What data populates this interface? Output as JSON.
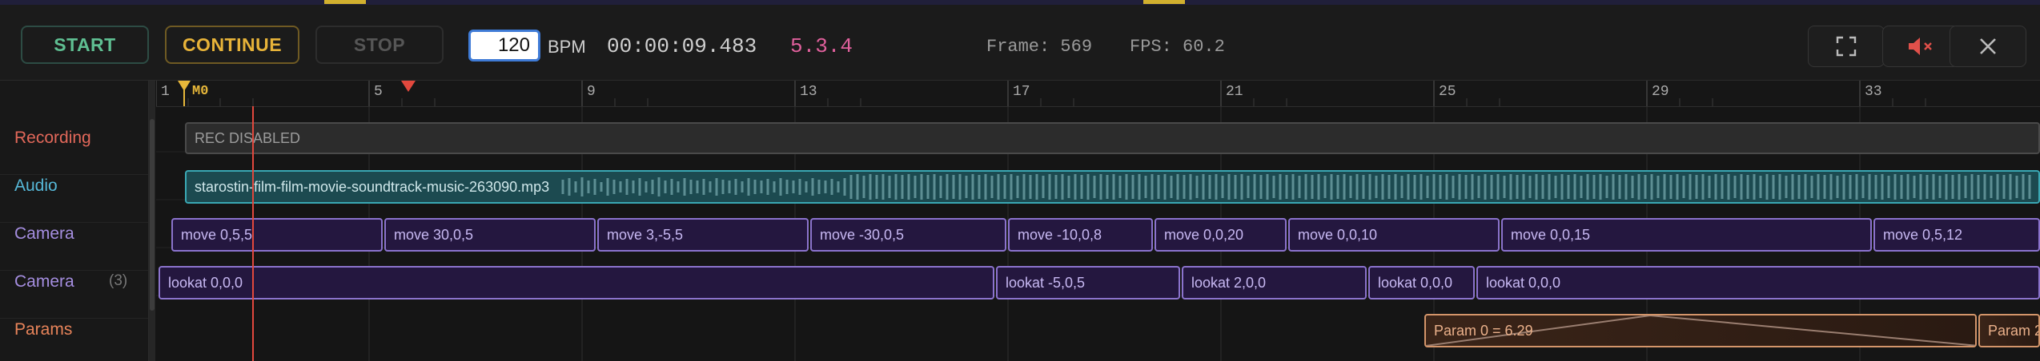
{
  "toolbar": {
    "start_label": "START",
    "continue_label": "CONTINUE",
    "stop_label": "STOP",
    "bpm_value": "120",
    "bpm_label": "BPM",
    "clock": "00:00:09.483",
    "position": "5.3.4",
    "frame": "Frame: 569",
    "fps": "FPS: 60.2",
    "icons": [
      "fullscreen-icon",
      "mute-icon",
      "close-icon"
    ]
  },
  "ruler": {
    "ticks": [
      "1",
      "5",
      "9",
      "13",
      "17",
      "21",
      "25",
      "29",
      "33"
    ],
    "marker_label": "M0"
  },
  "tracks": [
    {
      "label": "Recording",
      "color": "#e2685a"
    },
    {
      "label": "Audio",
      "color": "#56b8d8"
    },
    {
      "label": "Camera",
      "color": "#a58ee0"
    },
    {
      "label": "Camera",
      "count": "(3)",
      "color": "#a58ee0"
    },
    {
      "label": "Params",
      "color": "#e8845a"
    }
  ],
  "recording_clip": "REC DISABLED",
  "audio_clip": "starostin-film-film-movie-soundtrack-music-263090.mp3",
  "camera_clips": [
    "move  0,5,5",
    "move  30,0,5",
    "move  3,-5,5",
    "move  -30,0,5",
    "move  -10,0,8",
    "move  0,0,20",
    "move  0,0,10",
    "move  0,0,15",
    "move  0,5,12"
  ],
  "lookat_clips": [
    "lookat 0,0,0",
    "lookat -5,0,5",
    "lookat 2,0,0",
    "lookat 0,0,0",
    "lookat 0,0,0"
  ],
  "param_clips": [
    "Param 0 = 6.29",
    "Param 2"
  ],
  "colors": {
    "accent_blue": "#3f7bd6",
    "playhead": "#e2483d",
    "marker": "#e8b83a",
    "camera_clip": "#8b73cd",
    "audio_clip": "#3aa8b4",
    "param_clip": "#d4956a"
  }
}
